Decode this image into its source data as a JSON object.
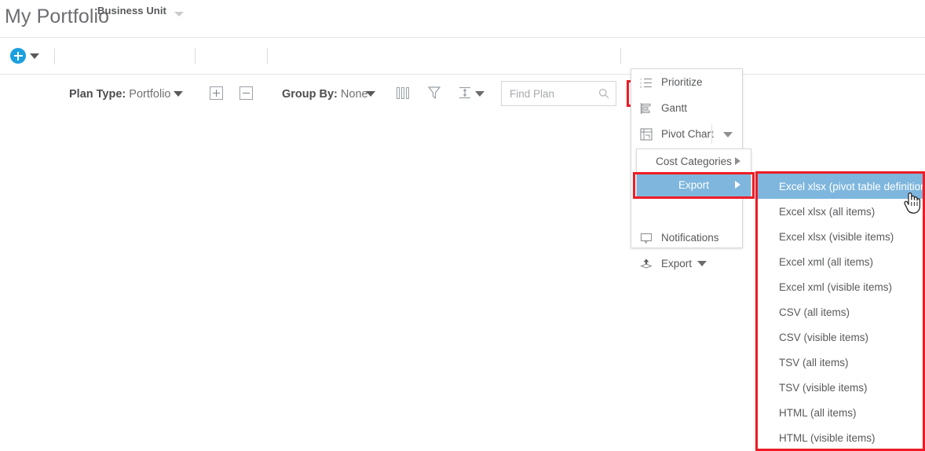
{
  "header": {
    "page_title": "My Portfolio",
    "business_unit_label": "Business Unit",
    "business_unit_caret_icon": "chevron-down-icon"
  },
  "toolbar": {
    "add_icon": "plus-circle-icon",
    "add_caret_icon": "chevron-down-icon",
    "plan_type_label": "Plan Type:",
    "plan_type_value": "Portfolio",
    "plan_type_caret_icon": "chevron-down-icon",
    "expand_all_icon": "expand-plus-icon",
    "collapse_all_icon": "collapse-minus-icon",
    "group_by_label": "Group By:",
    "group_by_value": "None",
    "group_by_caret_icon": "chevron-down-icon",
    "columns_icon": "columns-icon",
    "filter_icon": "filter-funnel-icon",
    "row_height_icon": "row-height-icon",
    "row_height_caret_icon": "chevron-down-icon",
    "search_placeholder": "Find Plan",
    "search_value": "",
    "search_icon": "search-icon",
    "more_actions_icon": "ellipsis-icon"
  },
  "menu": {
    "items": [
      {
        "label": "Prioritize",
        "icon": "prioritize-list-icon",
        "has_caret": false
      },
      {
        "label": "Gantt",
        "icon": "gantt-chart-icon",
        "has_caret": false
      },
      {
        "label": "Pivot Chart",
        "icon": "pivot-chart-icon",
        "has_caret": true
      },
      {
        "label": "Notifications",
        "icon": "notification-bubble-icon",
        "has_caret": false
      },
      {
        "label": "Export",
        "icon": "export-upload-icon",
        "has_caret": true
      }
    ]
  },
  "flyout": {
    "items": [
      {
        "label": "Cost Categories",
        "selected": false,
        "arrow_icon": "chevron-right-icon"
      },
      {
        "label": "Export",
        "selected": true,
        "arrow_icon": "chevron-right-icon"
      }
    ]
  },
  "export_submenu": {
    "items": [
      {
        "label": "Excel xlsx (pivot table definition)",
        "selected": true
      },
      {
        "label": "Excel xlsx (all items)",
        "selected": false
      },
      {
        "label": "Excel xlsx (visible items)",
        "selected": false
      },
      {
        "label": "Excel xml (all items)",
        "selected": false
      },
      {
        "label": "Excel xml (visible items)",
        "selected": false
      },
      {
        "label": "CSV (all items)",
        "selected": false
      },
      {
        "label": "CSV (visible items)",
        "selected": false
      },
      {
        "label": "TSV (all items)",
        "selected": false
      },
      {
        "label": "TSV (visible items)",
        "selected": false
      },
      {
        "label": "HTML (all items)",
        "selected": false
      },
      {
        "label": "HTML (visible items)",
        "selected": false
      }
    ]
  },
  "cursor": {
    "icon": "pointing-hand-cursor"
  },
  "colors": {
    "accent_blue": "#1a9fe0",
    "highlight_blue": "#7eb6dd",
    "annotation_red": "#ee1c25",
    "text_gray": "#58595b"
  }
}
